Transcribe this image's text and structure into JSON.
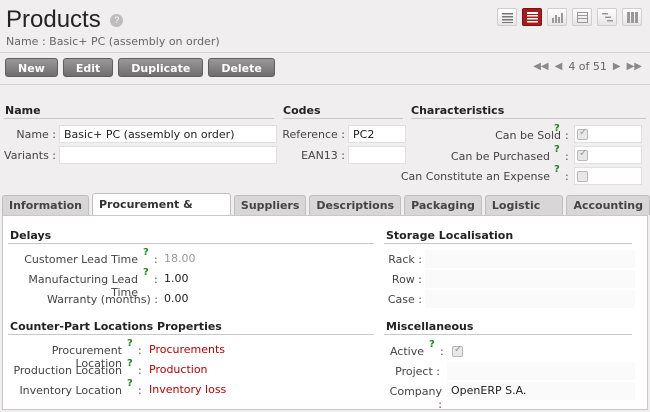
{
  "header": {
    "title": "Products",
    "help": "?",
    "subtitle": "Name : Basic+ PC (assembly on order)"
  },
  "views": [
    "list-view",
    "form-view",
    "graph-view",
    "calendar-view",
    "gantt-view",
    "kanban-view"
  ],
  "toolbar": {
    "new": "New",
    "edit": "Edit",
    "duplicate": "Duplicate",
    "delete": "Delete"
  },
  "pager": {
    "text": "4 of 51"
  },
  "name_section": {
    "title": "Name",
    "name_label": "Name :",
    "name_value": "Basic+ PC (assembly on order)",
    "variants_label": "Variants :",
    "variants_value": ""
  },
  "codes_section": {
    "title": "Codes",
    "reference_label": "Reference :",
    "reference_value": "PC2",
    "ean13_label": "EAN13 :",
    "ean13_value": ""
  },
  "characteristics": {
    "title": "Characteristics",
    "can_be_sold": "Can be Sold",
    "can_be_purchased": "Can be Purchased",
    "can_constitute_expense": "Can Constitute an Expense",
    "help": "?",
    "colon": ":"
  },
  "tabs": [
    "Information",
    "Procurement & Locations",
    "Suppliers",
    "Descriptions",
    "Packaging",
    "Logistic Flow",
    "Accounting"
  ],
  "delays": {
    "title": "Delays",
    "customer_lead_time_label": "Customer Lead Time",
    "customer_lead_time_value": "18.00",
    "manufacturing_lead_time_label": "Manufacturing Lead Time",
    "manufacturing_lead_time_value": "1.00",
    "warranty_label": "Warranty (months) :",
    "warranty_value": "0.00"
  },
  "storage": {
    "title": "Storage Localisation",
    "rack_label": "Rack :",
    "row_label": "Row :",
    "case_label": "Case :"
  },
  "counterpart": {
    "title": "Counter-Part Locations Properties",
    "procurement_label": "Procurement Location",
    "procurement_value": "Procurements",
    "production_label": "Production Location",
    "production_value": "Production",
    "inventory_label": "Inventory Location",
    "inventory_value": "Inventory loss"
  },
  "misc": {
    "title": "Miscellaneous",
    "active_label": "Active",
    "project_label": "Project :",
    "company_label": "Company :",
    "company_value": "OpenERP S.A."
  },
  "colors": {
    "accent": "#a51c1c",
    "link": "#bb0000",
    "help": "#1f8a1f"
  }
}
